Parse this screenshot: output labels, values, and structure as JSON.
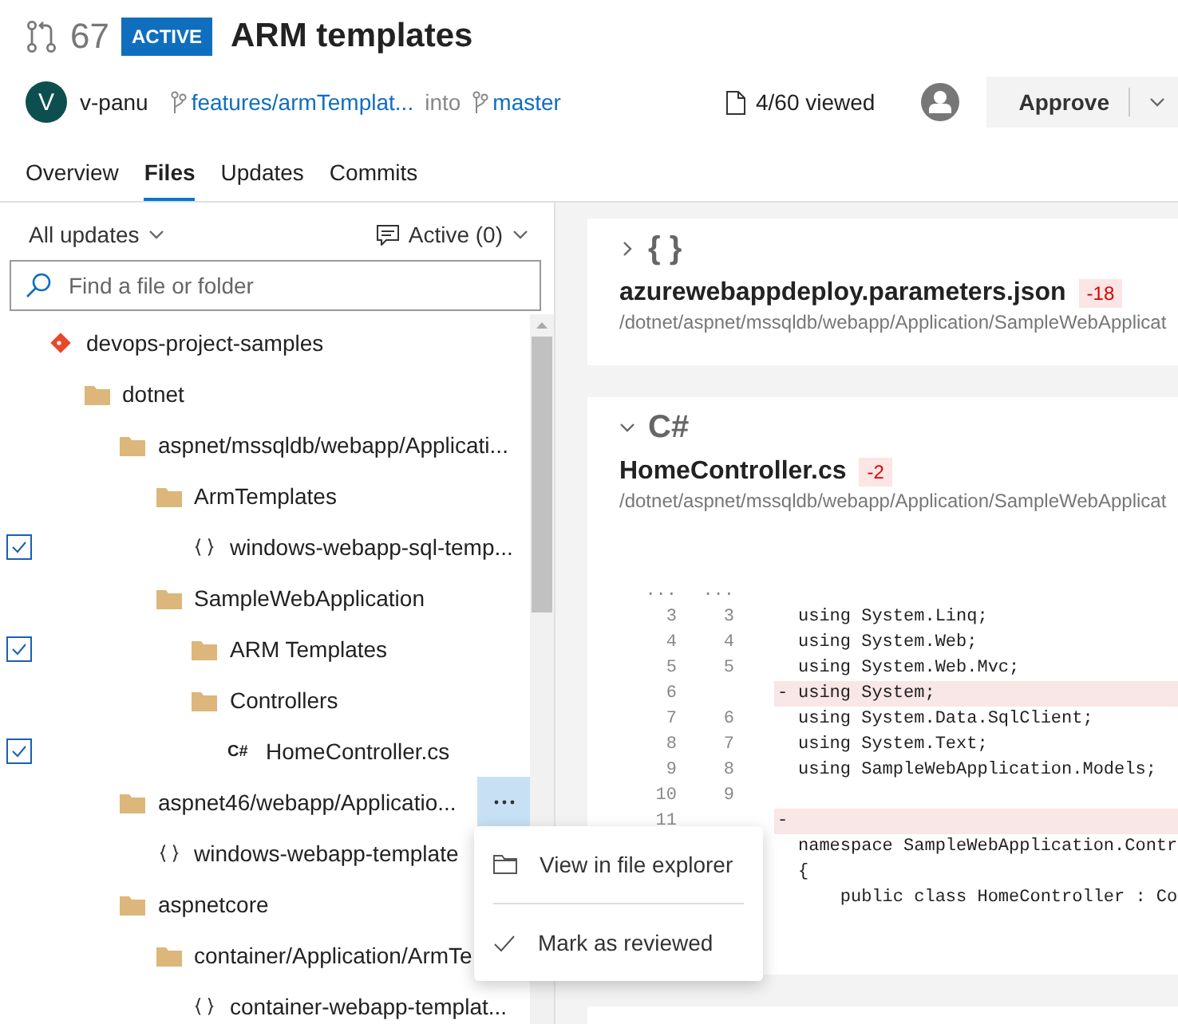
{
  "pr": {
    "number": "67",
    "status": "ACTIVE",
    "title": "ARM templates",
    "author_initial": "V",
    "author": "v-panu",
    "source_branch": "features/armTemplat...",
    "into": "into",
    "target_branch": "master",
    "viewed": "4/60 viewed",
    "approve": "Approve"
  },
  "tabs": [
    {
      "label": "Overview",
      "selected": false
    },
    {
      "label": "Files",
      "selected": true
    },
    {
      "label": "Updates",
      "selected": false
    },
    {
      "label": "Commits",
      "selected": false
    }
  ],
  "filters": {
    "updates": "All updates",
    "comments": "Active (0)"
  },
  "search": {
    "placeholder": "Find a file or folder"
  },
  "tree": [
    {
      "kind": "repo",
      "label": "devops-project-samples",
      "checked": false,
      "menu_open": false,
      "children": [
        {
          "kind": "folder",
          "label": "dotnet",
          "checked": false,
          "menu_open": false,
          "children": [
            {
              "kind": "folder",
              "label": "aspnet/mssqldb/webapp/Applicati...",
              "checked": false,
              "menu_open": false,
              "children": [
                {
                  "kind": "folder",
                  "label": "ArmTemplates",
                  "checked": false,
                  "menu_open": false,
                  "children": [
                    {
                      "kind": "json",
                      "label": "windows-webapp-sql-temp...",
                      "checked": true,
                      "menu_open": false
                    }
                  ]
                },
                {
                  "kind": "folder",
                  "label": "SampleWebApplication",
                  "checked": false,
                  "menu_open": false,
                  "children": [
                    {
                      "kind": "folder",
                      "label": "ARM Templates",
                      "checked": true,
                      "menu_open": false
                    },
                    {
                      "kind": "folder",
                      "label": "Controllers",
                      "checked": false,
                      "menu_open": false,
                      "children": [
                        {
                          "kind": "csharp",
                          "badge": "C#",
                          "label": "HomeController.cs",
                          "checked": true,
                          "menu_open": false
                        }
                      ]
                    }
                  ]
                }
              ]
            },
            {
              "kind": "folder",
              "label": "aspnet46/webapp/Applicatio...",
              "checked": false,
              "menu_open": true,
              "children": [
                {
                  "kind": "json",
                  "label": "windows-webapp-template",
                  "checked": false,
                  "menu_open": false
                }
              ]
            },
            {
              "kind": "folder",
              "label": "aspnetcore",
              "checked": false,
              "menu_open": false,
              "children": [
                {
                  "kind": "folder",
                  "label": "container/Application/ArmTe",
                  "checked": false,
                  "menu_open": false,
                  "children": [
                    {
                      "kind": "json",
                      "label": "container-webapp-templat...",
                      "checked": false,
                      "menu_open": false
                    }
                  ]
                }
              ]
            }
          ]
        }
      ]
    }
  ],
  "context_menu": [
    {
      "kind": "folder",
      "label": "View in file explorer"
    },
    {
      "kind": "check",
      "label": "Mark as reviewed"
    }
  ],
  "files": [
    {
      "type_label": "{ }",
      "expanded": false,
      "name": "azurewebappdeploy.parameters.json",
      "change": "-18",
      "path": "/dotnet/aspnet/mssqldb/webapp/Application/SampleWebApplicat"
    },
    {
      "type_label": "C#",
      "expanded": true,
      "name": "HomeController.cs",
      "change": "-2",
      "path": "/dotnet/aspnet/mssqldb/webapp/Application/SampleWebApplicat",
      "diff": {
        "old_top": "...",
        "new_top": "...",
        "lines": [
          {
            "old": "3",
            "new": "3",
            "kind": "context",
            "code": "using System.Linq;"
          },
          {
            "old": "4",
            "new": "4",
            "kind": "context",
            "code": "using System.Web;"
          },
          {
            "old": "5",
            "new": "5",
            "kind": "context",
            "code": "using System.Web.Mvc;"
          },
          {
            "old": "6",
            "kind": "removed",
            "marker": "-",
            "code": "using System;"
          },
          {
            "old": "7",
            "new": "6",
            "kind": "context",
            "code": "using System.Data.SqlClient;"
          },
          {
            "old": "8",
            "new": "7",
            "kind": "context",
            "code": "using System.Text;"
          },
          {
            "old": "9",
            "new": "8",
            "kind": "context",
            "code": "using SampleWebApplication.Models;"
          },
          {
            "old": "10",
            "new": "9",
            "kind": "context"
          },
          {
            "old": "11",
            "kind": "removed",
            "marker": "-"
          },
          {
            "kind": "context",
            "code": "namespace SampleWebApplication.Contr"
          },
          {
            "kind": "context",
            "code": "{"
          },
          {
            "kind": "context",
            "code": "    public class HomeController : Co"
          }
        ]
      }
    }
  ]
}
